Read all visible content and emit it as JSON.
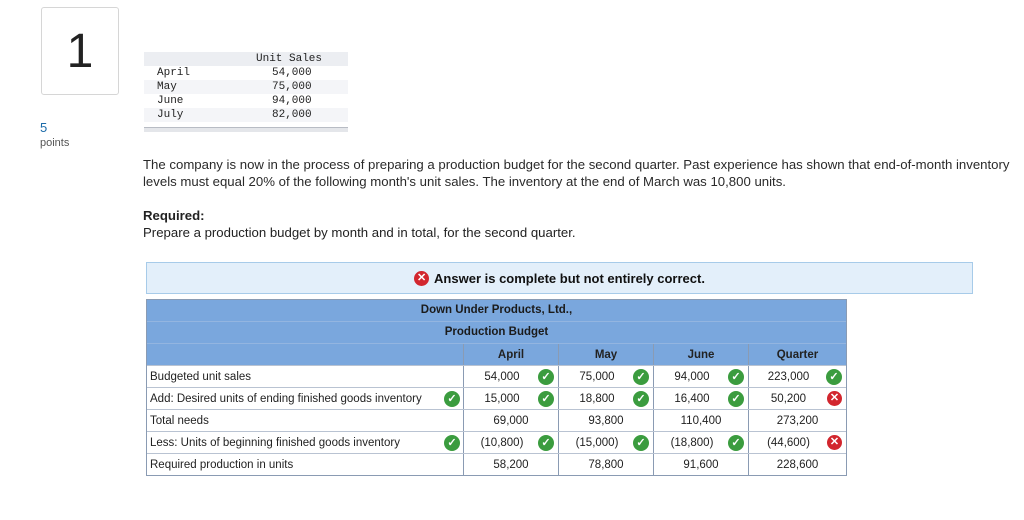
{
  "question": {
    "number": "1",
    "points_value": "5",
    "points_label": "points"
  },
  "unit_sales": {
    "header": "Unit Sales",
    "rows": [
      {
        "month": "April",
        "value": "54,000"
      },
      {
        "month": "May",
        "value": "75,000"
      },
      {
        "month": "June",
        "value": "94,000"
      },
      {
        "month": "July",
        "value": "82,000"
      }
    ]
  },
  "problem": {
    "paragraph": "The company is now in the process of preparing a production budget for the second quarter. Past experience has shown that end-of-month inventory levels must equal 20% of the following month's unit sales. The inventory at the end of March was 10,800 units.",
    "required_label": "Required:",
    "required_text": "Prepare a production budget by month and in total, for the second quarter."
  },
  "banner": {
    "text": "Answer is complete but not entirely correct.",
    "icon": "x-circle-icon",
    "color": "#d2262e"
  },
  "budget": {
    "company": "Down Under Products, Ltd.,",
    "title": "Production Budget",
    "columns": [
      "April",
      "May",
      "June",
      "Quarter"
    ],
    "rows": [
      {
        "label": "Budgeted unit sales",
        "label_mark": "",
        "cells": [
          {
            "value": "54,000",
            "mark": "check"
          },
          {
            "value": "75,000",
            "mark": "check"
          },
          {
            "value": "94,000",
            "mark": "check"
          },
          {
            "value": "223,000",
            "mark": "check"
          }
        ]
      },
      {
        "label": "Add: Desired units of ending finished goods inventory",
        "label_mark": "check",
        "cells": [
          {
            "value": "15,000",
            "mark": "check"
          },
          {
            "value": "18,800",
            "mark": "check"
          },
          {
            "value": "16,400",
            "mark": "check"
          },
          {
            "value": "50,200",
            "mark": "x"
          }
        ]
      },
      {
        "label": "Total needs",
        "label_mark": "",
        "cells": [
          {
            "value": "69,000",
            "mark": ""
          },
          {
            "value": "93,800",
            "mark": ""
          },
          {
            "value": "110,400",
            "mark": ""
          },
          {
            "value": "273,200",
            "mark": ""
          }
        ]
      },
      {
        "label": "Less: Units of beginning finished goods inventory",
        "label_mark": "check",
        "cells": [
          {
            "value": "(10,800)",
            "mark": "check"
          },
          {
            "value": "(15,000)",
            "mark": "check"
          },
          {
            "value": "(18,800)",
            "mark": "check"
          },
          {
            "value": "(44,600)",
            "mark": "x"
          }
        ]
      },
      {
        "label": "Required production in units",
        "label_mark": "",
        "cells": [
          {
            "value": "58,200",
            "mark": ""
          },
          {
            "value": "78,800",
            "mark": ""
          },
          {
            "value": "91,600",
            "mark": ""
          },
          {
            "value": "228,600",
            "mark": ""
          }
        ]
      }
    ],
    "colors": {
      "header_bg": "#7aa7dd",
      "check": "#3b9c3f",
      "cross": "#d2262e"
    }
  }
}
